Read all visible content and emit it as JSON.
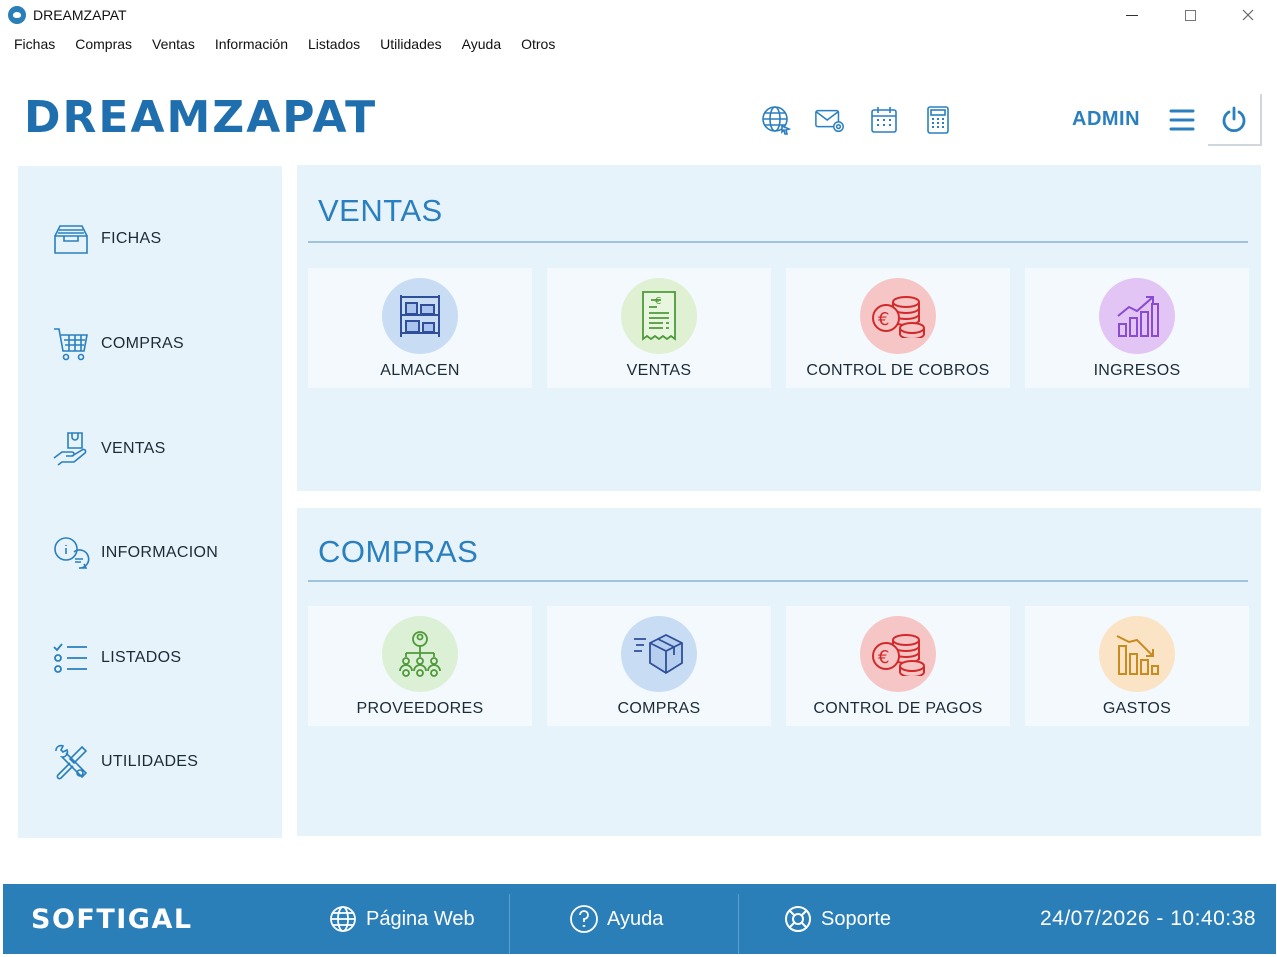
{
  "window": {
    "title": "DREAMZAPAT",
    "controls": {
      "minimize": "minimize-icon",
      "maximize": "maximize-icon",
      "close": "close-icon"
    }
  },
  "menubar": {
    "items": [
      "Fichas",
      "Compras",
      "Ventas",
      "Información",
      "Listados",
      "Utilidades",
      "Ayuda",
      "Otros"
    ]
  },
  "header": {
    "brand": "DREAMZAPAT",
    "tools": [
      "globe-icon",
      "email-icon",
      "calendar-icon",
      "calculator-icon"
    ],
    "user": "ADMIN",
    "menu_icon": "hamburger-icon",
    "power_icon": "power-icon"
  },
  "sidebar": {
    "items": [
      {
        "label": "FICHAS",
        "icon": "inbox-tray-icon"
      },
      {
        "label": "COMPRAS",
        "icon": "shopping-cart-icon"
      },
      {
        "label": "VENTAS",
        "icon": "hand-bag-icon"
      },
      {
        "label": "INFORMACION",
        "icon": "info-chat-icon"
      },
      {
        "label": "LISTADOS",
        "icon": "checklist-icon"
      },
      {
        "label": "UTILIDADES",
        "icon": "tools-icon"
      }
    ]
  },
  "ventas": {
    "title": "VENTAS",
    "tiles": [
      {
        "label": "ALMACEN",
        "icon": "warehouse-shelf-icon",
        "bg": "#c8dcf3"
      },
      {
        "label": "VENTAS",
        "icon": "receipt-icon",
        "bg": "#dff0d3"
      },
      {
        "label": "CONTROL DE COBROS",
        "icon": "euro-coins-icon",
        "bg": "#f6c6c6"
      },
      {
        "label": "INGRESOS",
        "icon": "rising-chart-icon",
        "bg": "#e2c4f5"
      }
    ]
  },
  "compras": {
    "title": "COMPRAS",
    "tiles": [
      {
        "label": "PROVEEDORES",
        "icon": "supplier-network-icon",
        "bg": "#dcf0d6"
      },
      {
        "label": "COMPRAS",
        "icon": "package-icon",
        "bg": "#c8dcf3"
      },
      {
        "label": "CONTROL DE PAGOS",
        "icon": "euro-coins-icon",
        "bg": "#f6c6c6"
      },
      {
        "label": "GASTOS",
        "icon": "falling-chart-icon",
        "bg": "#fbe4c6"
      }
    ]
  },
  "footer": {
    "brand": "SOFTIGAL",
    "links": [
      {
        "label": "Página Web",
        "icon": "globe-icon"
      },
      {
        "label": "Ayuda",
        "icon": "help-circle-icon"
      },
      {
        "label": "Soporte",
        "icon": "support-lifebuoy-icon"
      }
    ],
    "datetime": "24/07/2026 - 10:40:38"
  },
  "colors": {
    "accent": "#2a7fbf",
    "panel_bg": "#e6f3fb",
    "footer_bg": "#2a7fb8",
    "tile_bg": "#f3f9fd"
  }
}
